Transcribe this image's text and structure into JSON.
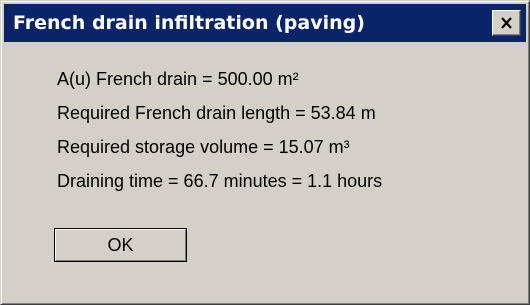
{
  "window": {
    "title": "French drain infiltration (paving)",
    "close_icon": "close-x-icon"
  },
  "message": {
    "lines": [
      "A(u) French drain = 500.00 m²",
      "Required French drain length = 53.84 m",
      "Required storage volume = 15.07 m³",
      "Draining time = 66.7 minutes = 1.1 hours"
    ]
  },
  "buttons": {
    "ok_label": "OK"
  },
  "colors": {
    "titlebar": "#0a246a",
    "title_text": "#ffffff",
    "face": "#d4d0c8"
  }
}
